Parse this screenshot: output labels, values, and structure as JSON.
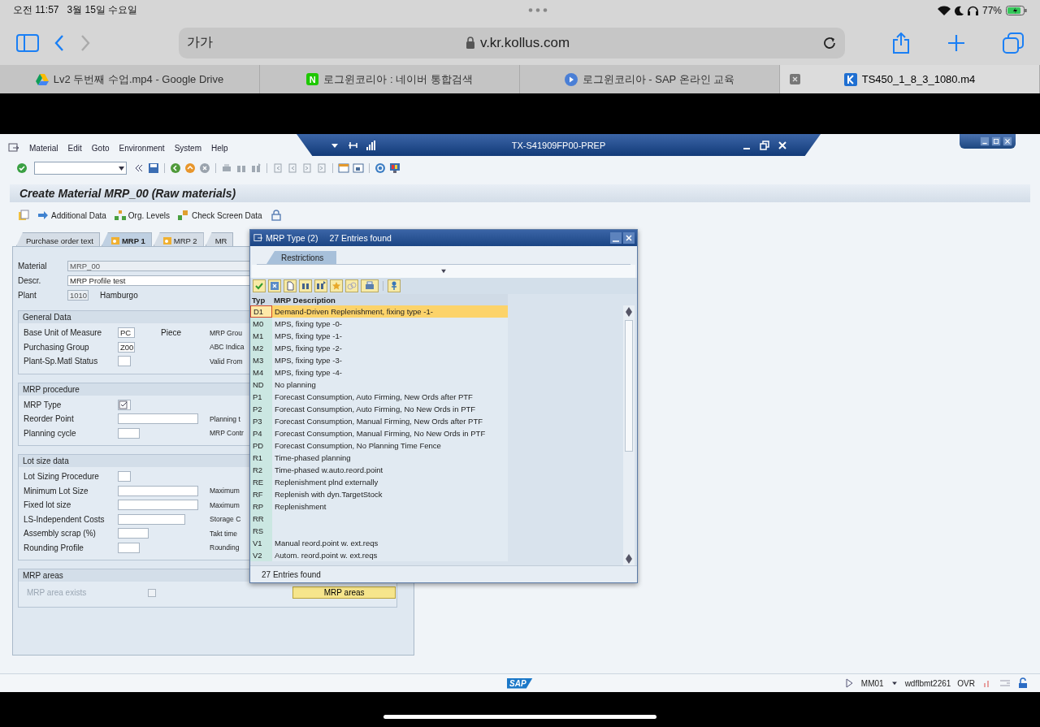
{
  "ipad_status": {
    "time": "오전 11:57",
    "date": "3월 15일 수요일",
    "battery": "77%"
  },
  "safari": {
    "text_size": "가가",
    "address": "v.kr.kollus.com",
    "tabs": [
      {
        "label": "Lv2 두번째 수업.mp4 - Google Drive",
        "selected": false,
        "kind": "drive"
      },
      {
        "label": "로그윈코리아 : 네이버 통합검색",
        "selected": false,
        "kind": "naver",
        "favicon": "N"
      },
      {
        "label": "로그윈코리아 - SAP 온라인 교육",
        "selected": false,
        "kind": "play"
      },
      {
        "label": "TS450_1_8_3_1080.m4",
        "selected": true,
        "kind": "kollus"
      }
    ]
  },
  "sap": {
    "menu": [
      "Material",
      "Edit",
      "Goto",
      "Environment",
      "System",
      "Help"
    ],
    "system_title": "TX-S41909FP00-PREP",
    "screen_title": "Create Material MRP_00 (Raw materials)",
    "app_toolbar": [
      "Additional Data",
      "Org. Levels",
      "Check Screen Data"
    ],
    "tabs": [
      {
        "label": "Purchase order text",
        "selected": false
      },
      {
        "label": "MRP 1",
        "selected": true
      },
      {
        "label": "MRP 2",
        "selected": false
      },
      {
        "label": "MR",
        "selected": false
      }
    ],
    "header_fields": [
      {
        "label": "Material",
        "value": "MRP_00",
        "kind": "readonly"
      },
      {
        "label": "Descr.",
        "value": "MRP Profile test",
        "kind": "text"
      },
      {
        "label": "Plant",
        "value": "1010",
        "note": "Hamburgo",
        "kind": "short"
      }
    ],
    "groups": [
      {
        "title": "General Data",
        "rows": [
          {
            "label": "Base Unit of Measure",
            "value": "PC",
            "note": "Piece",
            "right": "MRP Grou",
            "kind": "field"
          },
          {
            "label": "Purchasing Group",
            "value": "Z00",
            "right": "ABC Indica",
            "kind": "field"
          },
          {
            "label": "Plant-Sp.Matl Status",
            "right": "Valid From",
            "kind": "field"
          }
        ]
      },
      {
        "title": "MRP procedure",
        "rows": [
          {
            "label": "MRP Type",
            "kind": "help"
          },
          {
            "label": "Reorder Point",
            "right": "Planning t",
            "kind": "field"
          },
          {
            "label": "Planning cycle",
            "right": "MRP Contr",
            "kind": "field"
          }
        ]
      },
      {
        "title": "Lot size data",
        "rows": [
          {
            "label": "Lot Sizing Procedure",
            "kind": "field"
          },
          {
            "label": "Minimum Lot Size",
            "right": "Maximum",
            "kind": "field"
          },
          {
            "label": "Fixed lot size",
            "right": "Maximum",
            "kind": "field"
          },
          {
            "label": "LS-Independent Costs",
            "right": "Storage C",
            "kind": "field"
          },
          {
            "label": "Assembly scrap (%)",
            "right": "Takt time",
            "kind": "field"
          },
          {
            "label": "Rounding Profile",
            "right": "Rounding",
            "kind": "field"
          }
        ]
      }
    ],
    "mrp_areas": {
      "title": "MRP areas",
      "checkbox": {
        "label": "MRP area exists",
        "checked": false,
        "disabled": true
      },
      "button": "MRP areas"
    },
    "status_bar": {
      "logo": "SAP",
      "transaction": "MM01",
      "server": "wdflbmt2261",
      "mode": "OVR"
    }
  },
  "dialog": {
    "title": "MRP Type (2)",
    "count": "27 Entries found",
    "tabs": [
      {
        "label": "Restrictions",
        "selected": true
      }
    ],
    "columns": [
      "Typ",
      "MRP Description"
    ],
    "rows": [
      {
        "code": "D1",
        "description": "Demand-Driven Replenishment, fixing type -1-",
        "selected": true
      },
      {
        "code": "M0",
        "description": "MPS, fixing type -0-",
        "selected": false
      },
      {
        "code": "M1",
        "description": "MPS, fixing type -1-",
        "selected": false
      },
      {
        "code": "M2",
        "description": "MPS, fixing type -2-",
        "selected": false
      },
      {
        "code": "M3",
        "description": "MPS, fixing type -3-",
        "selected": false
      },
      {
        "code": "M4",
        "description": "MPS, fixing type -4-",
        "selected": false
      },
      {
        "code": "ND",
        "description": "No planning",
        "selected": false
      },
      {
        "code": "P1",
        "description": "Forecast Consumption, Auto Firming, New Ords after PTF",
        "selected": false
      },
      {
        "code": "P2",
        "description": "Forecast Consumption, Auto Firming, No New Ords in PTF",
        "selected": false
      },
      {
        "code": "P3",
        "description": "Forecast Consumption, Manual Firming, New Ords after PTF",
        "selected": false
      },
      {
        "code": "P4",
        "description": "Forecast Consumption, Manual Firming, No New Ords in PTF",
        "selected": false
      },
      {
        "code": "PD",
        "description": "Forecast Consumption, No Planning Time Fence",
        "selected": false
      },
      {
        "code": "R1",
        "description": "Time-phased planning",
        "selected": false
      },
      {
        "code": "R2",
        "description": "Time-phased w.auto.reord.point",
        "selected": false
      },
      {
        "code": "RE",
        "description": "Replenishment plnd externally",
        "selected": false
      },
      {
        "code": "RF",
        "description": "Replenish with dyn.TargetStock",
        "selected": false
      },
      {
        "code": "RP",
        "description": "Replenishment",
        "selected": false
      },
      {
        "code": "RR",
        "selected": false
      },
      {
        "code": "RS",
        "selected": false
      },
      {
        "code": "V1",
        "description": "Manual reord.point w. ext.reqs",
        "selected": false
      },
      {
        "code": "V2",
        "description": "Autom. reord.point w. ext.reqs",
        "selected": false
      }
    ],
    "status": "27 Entries found"
  }
}
